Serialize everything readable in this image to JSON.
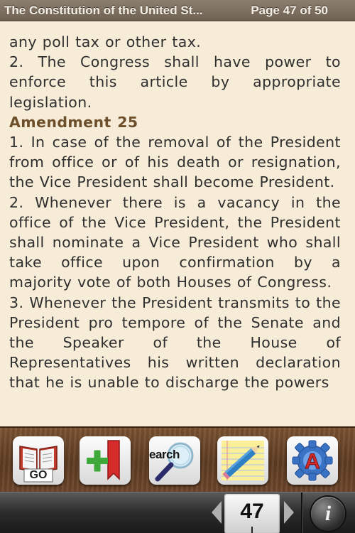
{
  "header": {
    "title": "The Constitution of the United St...",
    "page_indicator": "Page 47 of 50"
  },
  "reader": {
    "paragraphs": [
      {
        "type": "text",
        "text": "any poll tax or other tax."
      },
      {
        "type": "text",
        "text": "2. The Congress shall have power to enforce this article by appropriate legislation."
      },
      {
        "type": "heading",
        "text": "Amendment 25"
      },
      {
        "type": "text",
        "text": "1. In case of the removal of the President from office or of his death or resignation, the Vice President shall become President."
      },
      {
        "type": "text",
        "text": "2. Whenever there is a vacancy in the office of the Vice President, the President shall nominate a Vice President who shall take office upon confirmation by a majority vote of both Houses of Congress."
      },
      {
        "type": "text",
        "text": "3. Whenever the President transmits to the President pro tempore of the Senate and the Speaker of the House of Representatives his written declaration that he is unable to discharge the powers"
      }
    ]
  },
  "toolbar": {
    "go_label": "GO",
    "search_label": "earch",
    "icons": [
      "go-book-icon",
      "add-bookmark-icon",
      "search-icon",
      "notes-pencil-icon",
      "settings-gear-icon"
    ]
  },
  "bottom": {
    "page_number": "47",
    "info_label": "i"
  },
  "colors": {
    "page_bg": "#f6ecd7",
    "text": "#2f2f2f",
    "heading": "#6e4f2b",
    "header_bg": "#7d7061",
    "toolbar_wood": "#6b4529",
    "bookmark_red": "#d62b2b",
    "plus_green": "#3fa83a"
  }
}
